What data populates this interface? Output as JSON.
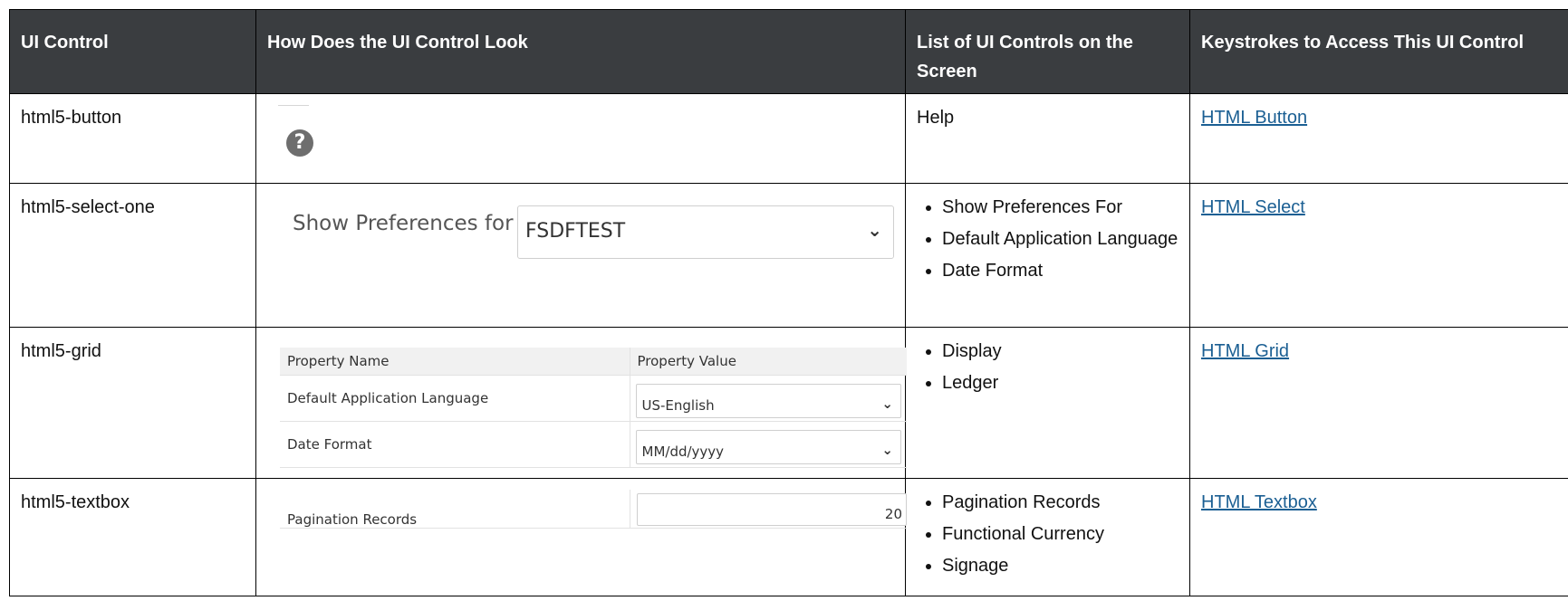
{
  "headers": [
    "UI Control",
    "How Does the UI Control Look",
    "List of UI Controls on the Screen",
    "Keystrokes to Access This UI Control"
  ],
  "rows": [
    {
      "control": "html5-button",
      "controls_list": [
        "Help"
      ],
      "link": "HTML Button",
      "demo": {
        "icon": "help-question-icon",
        "icon_glyph": "?"
      }
    },
    {
      "control": "html5-select-one",
      "controls_list": [
        "Show Preferences For",
        "Default Application Language",
        "Date Format"
      ],
      "link": "HTML Select",
      "demo": {
        "label": "Show Preferences for",
        "value": "FSDFTEST"
      }
    },
    {
      "control": "html5-grid",
      "controls_list": [
        "Display",
        "Ledger"
      ],
      "link": "HTML Grid",
      "demo": {
        "columns": [
          "Property Name",
          "Property Value"
        ],
        "rows": [
          {
            "name": "Default Application Language",
            "value": "US-English"
          },
          {
            "name": "Date Format",
            "value": "MM/dd/yyyy"
          }
        ]
      }
    },
    {
      "control": "html5-textbox",
      "controls_list": [
        "Pagination Records",
        "Functional Currency",
        "Signage"
      ],
      "link": "HTML Textbox",
      "demo": {
        "label": "Pagination Records",
        "value": "20"
      }
    }
  ],
  "colors": {
    "header_bg": "#3a3d40",
    "link": "#1b5f93",
    "icon_bg": "#6e6e6e"
  }
}
